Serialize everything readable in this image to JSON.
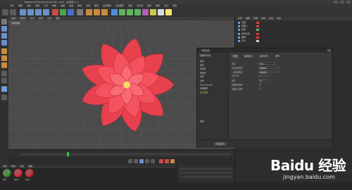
{
  "app": {
    "title": "CINEMA 4D R19.024 Studio (RC - R19) - [未标题 1 *]",
    "menus": [
      "文件",
      "编辑",
      "创建",
      "选择",
      "工具",
      "网格",
      "捕捉",
      "动画",
      "模拟",
      "渲染",
      "雕刻",
      "运动跟踪",
      "运动图形",
      "角色",
      "流水线",
      "插件",
      "脚本",
      "窗口",
      "帮助"
    ]
  },
  "viewport": {
    "menus": [
      "查看",
      "摄像机",
      "显示",
      "选项",
      "过滤",
      "面板"
    ],
    "label": "透视视图",
    "colors": {
      "petal": "#f0414e",
      "petal_edge": "#c92834",
      "center": "#f7d96b",
      "background": "#4b4b4b",
      "grid": "#5c5c5c"
    }
  },
  "object_manager": {
    "menus": [
      "文件",
      "编辑",
      "查看",
      "对象",
      "标签",
      "书签"
    ],
    "objects": [
      {
        "name": "花瓣",
        "tag_color": "#e23a3a"
      },
      {
        "name": "花瓣.1",
        "tag_color": "#e23a3a"
      },
      {
        "name": "克隆",
        "tag_color": "#6bb36b"
      },
      {
        "name": "样条约束",
        "tag_color": "#e23a3a"
      },
      {
        "name": "螺旋",
        "tag_color": "#e23a3a"
      },
      {
        "name": "灯光",
        "tag_color": "#d0d0d0"
      }
    ]
  },
  "dialog": {
    "title": "渲染设置",
    "left_header": "渲染器 标准",
    "left_items": [
      {
        "label": "输出",
        "highlight": false
      },
      {
        "label": "保存",
        "highlight": false
      },
      {
        "label": "多通道",
        "highlight": false
      },
      {
        "label": "抗锯齿",
        "highlight": false
      },
      {
        "label": "选项",
        "highlight": false
      },
      {
        "label": "立体",
        "highlight": false
      },
      {
        "label": "Team Render",
        "highlight": false
      },
      {
        "label": "材质覆写",
        "highlight": false
      },
      {
        "label": "全局光照",
        "highlight": true
      }
    ],
    "tabs": [
      "常规",
      "辐照缓存",
      "缓存文件",
      "细节"
    ],
    "rows": [
      {
        "key": "预设",
        "value": "室内"
      },
      {
        "key": "首次反弹算法",
        "value": "辐照缓存"
      },
      {
        "key": "二次反弹算法",
        "value": "辐照缓存"
      },
      {
        "key": "Gamma",
        "value": "1"
      },
      {
        "key": "采样",
        "value": "中"
      },
      {
        "key": "离散区域采样",
        "value": "✓"
      },
      {
        "key": "离散天空采样",
        "value": "✓"
      }
    ],
    "effect_button": "效果...",
    "bottom_button": "渲染设置..."
  },
  "timeline": {
    "current_frame": 20
  },
  "materials": {
    "menus": [
      "创建",
      "编辑",
      "功能",
      "纹理"
    ],
    "items": [
      {
        "label": "材质",
        "color": "#4a9e3a"
      },
      {
        "label": "材质.1",
        "color": "#e8333f"
      },
      {
        "label": "材质.2",
        "color": "#d9303c"
      }
    ]
  },
  "watermark": {
    "logo": "Baidu 经验",
    "url": "jingyan.baidu.com"
  }
}
